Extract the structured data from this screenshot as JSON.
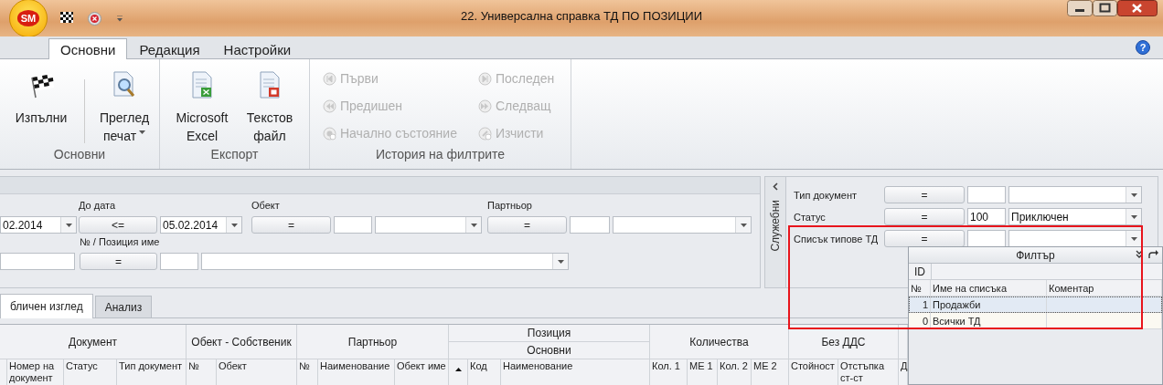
{
  "app": {
    "logo": "SM"
  },
  "window": {
    "title": "22. Универсална справка ТД ПО ПОЗИЦИИ"
  },
  "ribbon": {
    "tabs": [
      {
        "label": "Основни",
        "selected": true
      },
      {
        "label": "Редакция",
        "selected": false
      },
      {
        "label": "Настройки",
        "selected": false
      }
    ],
    "help": "?",
    "groups": [
      {
        "title": "Основни",
        "buttons": [
          {
            "kind": "flag",
            "label": "Изпълни",
            "dropdown": false
          },
          {
            "kind": "preview",
            "label": "Преглед печат",
            "dropdown": true
          }
        ]
      },
      {
        "title": "Експорт",
        "buttons": [
          {
            "kind": "excel",
            "label": "Microsoft Excel",
            "dropdown": false
          },
          {
            "kind": "textfile",
            "label": "Текстов файл",
            "dropdown": false
          }
        ]
      },
      {
        "title": "История на филтрите",
        "small_buttons": [
          {
            "kind": "first",
            "label": "Първи",
            "disabled": true
          },
          {
            "kind": "prev",
            "label": "Предишен",
            "disabled": true
          },
          {
            "kind": "reset",
            "label": "Начално състояние",
            "disabled": true
          },
          {
            "kind": "last",
            "label": "Последен",
            "disabled": true
          },
          {
            "kind": "next",
            "label": "Следващ",
            "disabled": true
          },
          {
            "kind": "clear",
            "label": "Изчисти",
            "disabled": true
          }
        ]
      }
    ]
  },
  "filters": {
    "rows": [
      [
        {
          "kind": "date",
          "value": "02.2014"
        },
        {
          "kind": "date",
          "label": "До дата",
          "operator": "<=",
          "value": "05.02.2014"
        },
        {
          "kind": "lookup",
          "label": "Обект",
          "operator": "="
        },
        {
          "kind": "lookup",
          "label": "Партньор",
          "operator": "="
        }
      ],
      [
        {
          "kind": "text"
        },
        {
          "kind": "lookup",
          "label": "№ / Позиция име",
          "operator": "="
        }
      ]
    ]
  },
  "service_panel": {
    "title": "Служебни",
    "fields": [
      {
        "label": "Тип документ",
        "operator": "="
      },
      {
        "label": "Статус",
        "operator": "=",
        "code": "100",
        "name": "Приключен"
      },
      {
        "label": "Списък типове ТД",
        "operator": "="
      }
    ]
  },
  "view_tabs": [
    {
      "label": "бличен изглед",
      "selected": true
    },
    {
      "label": "Анализ",
      "selected": false
    }
  ],
  "grid": {
    "groups": [
      {
        "label": "Документ",
        "columns": [
          {
            "kind": "blank"
          },
          {
            "kind": "text",
            "label": "Номер на документ"
          },
          {
            "kind": "text",
            "label": "Статус"
          },
          {
            "kind": "text",
            "label": "Тип документ"
          }
        ]
      },
      {
        "label": "Обект - Собственик",
        "columns": [
          {
            "kind": "text",
            "label": "№"
          },
          {
            "kind": "text",
            "label": "Обект"
          }
        ]
      },
      {
        "label": "Партньор",
        "columns": [
          {
            "kind": "text",
            "label": "№"
          },
          {
            "kind": "text",
            "label": "Наименование"
          },
          {
            "kind": "text",
            "label": "Обект име"
          }
        ]
      },
      {
        "label": "Позиция",
        "subgroup": "Основни",
        "columns": [
          {
            "kind": "sort",
            "sorted": true
          },
          {
            "kind": "text",
            "label": "Код"
          },
          {
            "kind": "text",
            "label": "Наименование"
          }
        ]
      },
      {
        "label": "Количества",
        "columns": [
          {
            "kind": "text",
            "label": "Кол. 1"
          },
          {
            "kind": "text",
            "label": "МЕ 1"
          },
          {
            "kind": "text",
            "label": "Кол. 2"
          },
          {
            "kind": "text",
            "label": "МЕ 2"
          }
        ]
      },
      {
        "label": "Без ДДС",
        "columns": [
          {
            "kind": "text",
            "label": "Стойност"
          },
          {
            "kind": "text",
            "label": "Отстъпка ст-ст"
          }
        ]
      },
      {
        "columns": [
          {
            "kind": "text",
            "label": "Д"
          }
        ]
      }
    ]
  },
  "filter_popup": {
    "title": "Филтър",
    "band": "ID",
    "columns": [
      "№",
      "Име на списъка",
      "Коментар"
    ],
    "rows": [
      {
        "number": "1",
        "name": "Продажби",
        "selected": true
      },
      {
        "number": "0",
        "name": "Всички ТД",
        "selected": false
      }
    ]
  }
}
